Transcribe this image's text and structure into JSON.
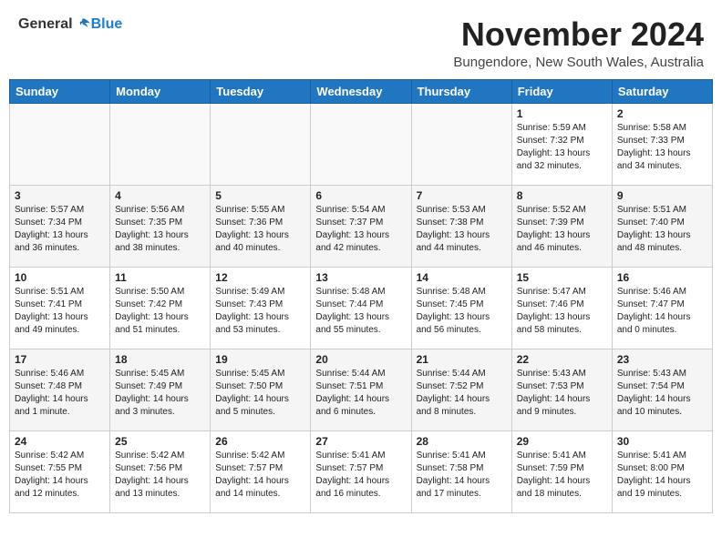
{
  "header": {
    "logo_general": "General",
    "logo_blue": "Blue",
    "month": "November 2024",
    "location": "Bungendore, New South Wales, Australia"
  },
  "days_of_week": [
    "Sunday",
    "Monday",
    "Tuesday",
    "Wednesday",
    "Thursday",
    "Friday",
    "Saturday"
  ],
  "weeks": [
    [
      {
        "day": "",
        "info": ""
      },
      {
        "day": "",
        "info": ""
      },
      {
        "day": "",
        "info": ""
      },
      {
        "day": "",
        "info": ""
      },
      {
        "day": "",
        "info": ""
      },
      {
        "day": "1",
        "info": "Sunrise: 5:59 AM\nSunset: 7:32 PM\nDaylight: 13 hours\nand 32 minutes."
      },
      {
        "day": "2",
        "info": "Sunrise: 5:58 AM\nSunset: 7:33 PM\nDaylight: 13 hours\nand 34 minutes."
      }
    ],
    [
      {
        "day": "3",
        "info": "Sunrise: 5:57 AM\nSunset: 7:34 PM\nDaylight: 13 hours\nand 36 minutes."
      },
      {
        "day": "4",
        "info": "Sunrise: 5:56 AM\nSunset: 7:35 PM\nDaylight: 13 hours\nand 38 minutes."
      },
      {
        "day": "5",
        "info": "Sunrise: 5:55 AM\nSunset: 7:36 PM\nDaylight: 13 hours\nand 40 minutes."
      },
      {
        "day": "6",
        "info": "Sunrise: 5:54 AM\nSunset: 7:37 PM\nDaylight: 13 hours\nand 42 minutes."
      },
      {
        "day": "7",
        "info": "Sunrise: 5:53 AM\nSunset: 7:38 PM\nDaylight: 13 hours\nand 44 minutes."
      },
      {
        "day": "8",
        "info": "Sunrise: 5:52 AM\nSunset: 7:39 PM\nDaylight: 13 hours\nand 46 minutes."
      },
      {
        "day": "9",
        "info": "Sunrise: 5:51 AM\nSunset: 7:40 PM\nDaylight: 13 hours\nand 48 minutes."
      }
    ],
    [
      {
        "day": "10",
        "info": "Sunrise: 5:51 AM\nSunset: 7:41 PM\nDaylight: 13 hours\nand 49 minutes."
      },
      {
        "day": "11",
        "info": "Sunrise: 5:50 AM\nSunset: 7:42 PM\nDaylight: 13 hours\nand 51 minutes."
      },
      {
        "day": "12",
        "info": "Sunrise: 5:49 AM\nSunset: 7:43 PM\nDaylight: 13 hours\nand 53 minutes."
      },
      {
        "day": "13",
        "info": "Sunrise: 5:48 AM\nSunset: 7:44 PM\nDaylight: 13 hours\nand 55 minutes."
      },
      {
        "day": "14",
        "info": "Sunrise: 5:48 AM\nSunset: 7:45 PM\nDaylight: 13 hours\nand 56 minutes."
      },
      {
        "day": "15",
        "info": "Sunrise: 5:47 AM\nSunset: 7:46 PM\nDaylight: 13 hours\nand 58 minutes."
      },
      {
        "day": "16",
        "info": "Sunrise: 5:46 AM\nSunset: 7:47 PM\nDaylight: 14 hours\nand 0 minutes."
      }
    ],
    [
      {
        "day": "17",
        "info": "Sunrise: 5:46 AM\nSunset: 7:48 PM\nDaylight: 14 hours\nand 1 minute."
      },
      {
        "day": "18",
        "info": "Sunrise: 5:45 AM\nSunset: 7:49 PM\nDaylight: 14 hours\nand 3 minutes."
      },
      {
        "day": "19",
        "info": "Sunrise: 5:45 AM\nSunset: 7:50 PM\nDaylight: 14 hours\nand 5 minutes."
      },
      {
        "day": "20",
        "info": "Sunrise: 5:44 AM\nSunset: 7:51 PM\nDaylight: 14 hours\nand 6 minutes."
      },
      {
        "day": "21",
        "info": "Sunrise: 5:44 AM\nSunset: 7:52 PM\nDaylight: 14 hours\nand 8 minutes."
      },
      {
        "day": "22",
        "info": "Sunrise: 5:43 AM\nSunset: 7:53 PM\nDaylight: 14 hours\nand 9 minutes."
      },
      {
        "day": "23",
        "info": "Sunrise: 5:43 AM\nSunset: 7:54 PM\nDaylight: 14 hours\nand 10 minutes."
      }
    ],
    [
      {
        "day": "24",
        "info": "Sunrise: 5:42 AM\nSunset: 7:55 PM\nDaylight: 14 hours\nand 12 minutes."
      },
      {
        "day": "25",
        "info": "Sunrise: 5:42 AM\nSunset: 7:56 PM\nDaylight: 14 hours\nand 13 minutes."
      },
      {
        "day": "26",
        "info": "Sunrise: 5:42 AM\nSunset: 7:57 PM\nDaylight: 14 hours\nand 14 minutes."
      },
      {
        "day": "27",
        "info": "Sunrise: 5:41 AM\nSunset: 7:57 PM\nDaylight: 14 hours\nand 16 minutes."
      },
      {
        "day": "28",
        "info": "Sunrise: 5:41 AM\nSunset: 7:58 PM\nDaylight: 14 hours\nand 17 minutes."
      },
      {
        "day": "29",
        "info": "Sunrise: 5:41 AM\nSunset: 7:59 PM\nDaylight: 14 hours\nand 18 minutes."
      },
      {
        "day": "30",
        "info": "Sunrise: 5:41 AM\nSunset: 8:00 PM\nDaylight: 14 hours\nand 19 minutes."
      }
    ]
  ]
}
